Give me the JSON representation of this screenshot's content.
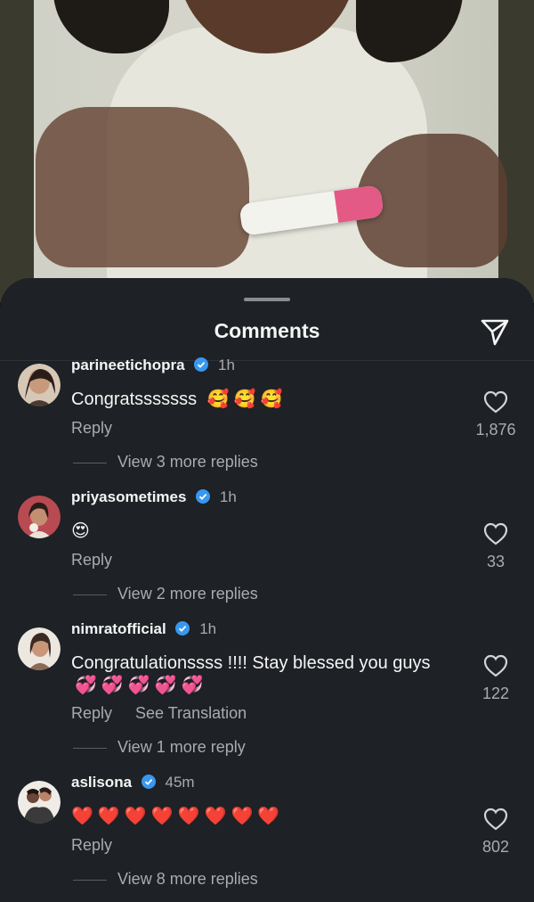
{
  "sheet": {
    "title": "Comments"
  },
  "comments": [
    {
      "username": "parineetichopra",
      "time": "1h",
      "text": "Congratsssssss",
      "emojis": [
        "🥰",
        "🥰",
        "🥰"
      ],
      "reply_label": "Reply",
      "likes": "1,876",
      "view_more": "View 3 more replies"
    },
    {
      "username": "priyasometimes",
      "time": "1h",
      "text": "",
      "emojis": [
        "😍"
      ],
      "reply_label": "Reply",
      "likes": "33",
      "view_more": "View 2 more replies"
    },
    {
      "username": "nimratofficial",
      "time": "1h",
      "text": "Congratulationssss !!!! Stay blessed you guys",
      "emojis": [
        "💞",
        "💞",
        "💞",
        "💞",
        "💞"
      ],
      "reply_label": "Reply",
      "translate_label": "See Translation",
      "likes": "122",
      "view_more": "View 1 more reply"
    },
    {
      "username": "aslisona",
      "time": "45m",
      "text": "",
      "emojis": [
        "❤️",
        "❤️",
        "❤️",
        "❤️",
        "❤️",
        "❤️",
        "❤️",
        "❤️"
      ],
      "reply_label": "Reply",
      "likes": "802",
      "view_more": "View 8 more replies"
    }
  ],
  "colors": {
    "sheet_bg": "#1e2125",
    "verified": "#3897f0",
    "muted_text": "#a8acb1"
  },
  "icons": {
    "share": "paper-plane-icon",
    "like": "heart-outline-icon",
    "verified": "verified-badge-icon"
  }
}
